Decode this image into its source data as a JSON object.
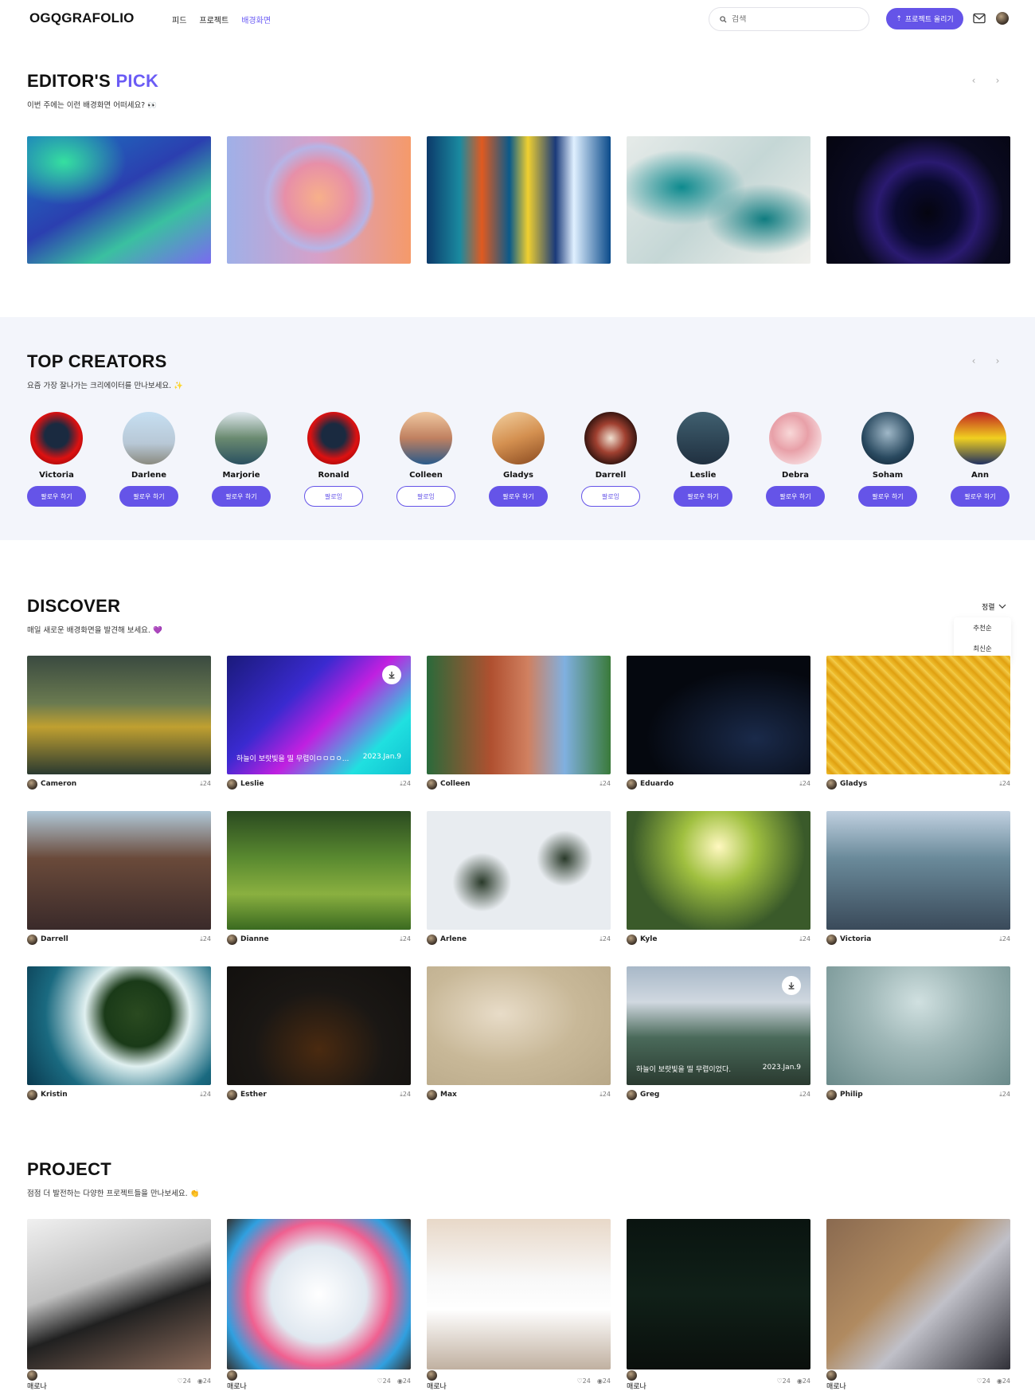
{
  "header": {
    "logo": "OGQGRAFOLIO",
    "nav": [
      "피드",
      "프로젝트",
      "배경화면"
    ],
    "active_nav": "배경화면",
    "search_placeholder": "검색",
    "upload_label": "프로젝트 올리기"
  },
  "editors_pick": {
    "title_main": "EDITOR'S ",
    "title_accent": "PICK",
    "subtitle": "이번 주에는 이런 배경화면 어떠세요? 👀"
  },
  "top_creators": {
    "title": "TOP CREATORS",
    "subtitle": "요즘 가장 잘나가는 크리에이터를 만나보세요. ✨",
    "creators": [
      {
        "name": "Victoria",
        "button": "팔로우 하기",
        "following": false
      },
      {
        "name": "Darlene",
        "button": "팔로우 하기",
        "following": false
      },
      {
        "name": "Marjorie",
        "button": "팔로우 하기",
        "following": false
      },
      {
        "name": "Ronald",
        "button": "팔로잉",
        "following": true
      },
      {
        "name": "Colleen",
        "button": "팔로잉",
        "following": true
      },
      {
        "name": "Gladys",
        "button": "팔로우 하기",
        "following": false
      },
      {
        "name": "Darrell",
        "button": "팔로잉",
        "following": true
      },
      {
        "name": "Leslie",
        "button": "팔로우 하기",
        "following": false
      },
      {
        "name": "Debra",
        "button": "팔로우 하기",
        "following": false
      },
      {
        "name": "Soham",
        "button": "팔로우 하기",
        "following": false
      },
      {
        "name": "Ann",
        "button": "팔로우 하기",
        "following": false
      }
    ]
  },
  "discover": {
    "title": "DISCOVER",
    "subtitle": "매일 새로운 배경화면을 발견해 보세요. 💜",
    "sort_label": "정렬",
    "sort_options": [
      "추천순",
      "최신순"
    ],
    "tiles": [
      {
        "author": "Cameron",
        "downloads": "24"
      },
      {
        "author": "Leslie",
        "downloads": "24",
        "overlay_title": "하늘이 보랏빛을 띨 무렵이ㅁㅁㅁㅇ...",
        "overlay_date": "2023.Jan.9"
      },
      {
        "author": "Colleen",
        "downloads": "24"
      },
      {
        "author": "Eduardo",
        "downloads": "24"
      },
      {
        "author": "Gladys",
        "downloads": "24"
      },
      {
        "author": "Darrell",
        "downloads": "24"
      },
      {
        "author": "Dianne",
        "downloads": "24"
      },
      {
        "author": "Arlene",
        "downloads": "24"
      },
      {
        "author": "Kyle",
        "downloads": "24"
      },
      {
        "author": "Victoria",
        "downloads": "24"
      },
      {
        "author": "Kristin",
        "downloads": "24"
      },
      {
        "author": "Esther",
        "downloads": "24"
      },
      {
        "author": "Max",
        "downloads": "24"
      },
      {
        "author": "Greg",
        "downloads": "24",
        "overlay_title": "하늘이 보랏빛을 띨 무렵이었다.",
        "overlay_date": "2023.Jan.9"
      },
      {
        "author": "Philip",
        "downloads": "24"
      }
    ]
  },
  "project": {
    "title": "PROJECT",
    "subtitle": "점점 더 발전하는 다양한 프로젝트들을 만나보세요. 👏",
    "items": [
      {
        "author": "매로나",
        "likes": "24",
        "views": "24"
      },
      {
        "author": "매로나",
        "likes": "24",
        "views": "24"
      },
      {
        "author": "매로나",
        "likes": "24",
        "views": "24"
      },
      {
        "author": "매로나",
        "likes": "24",
        "views": "24"
      },
      {
        "author": "매로나",
        "likes": "24",
        "views": "24"
      }
    ]
  },
  "colors": {
    "accent": "#6554e8",
    "creators_bg": "#f3f5fb"
  }
}
